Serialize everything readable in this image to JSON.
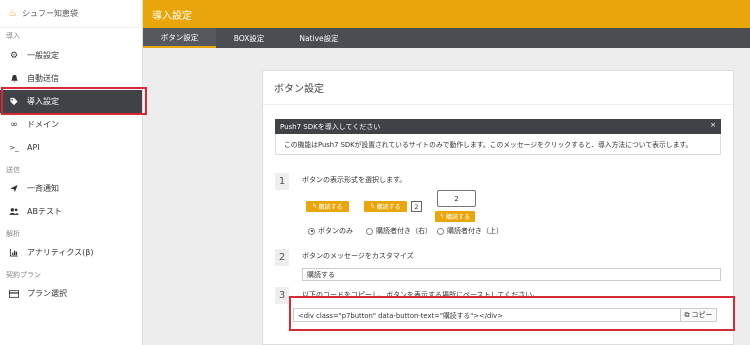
{
  "brand": {
    "name": "シュフー知恵袋",
    "icon": "bottle-icon"
  },
  "sidebar": {
    "sections": [
      {
        "label": "導入",
        "items": [
          {
            "label": "一般設定",
            "icon": "gear-icon"
          },
          {
            "label": "自動送信",
            "icon": "bell-icon"
          },
          {
            "label": "導入設定",
            "icon": "tag-icon",
            "active": true
          },
          {
            "label": "ドメイン",
            "icon": "link-icon"
          },
          {
            "label": "API",
            "icon": "terminal-icon"
          }
        ]
      },
      {
        "label": "送信",
        "items": [
          {
            "label": "一斉通知",
            "icon": "send-icon"
          },
          {
            "label": "ABテスト",
            "icon": "users-icon"
          }
        ]
      },
      {
        "label": "解析",
        "items": [
          {
            "label": "アナリティクス(β)",
            "icon": "bar-chart-icon"
          }
        ]
      },
      {
        "label": "契約プラン",
        "items": [
          {
            "label": "プラン選択",
            "icon": "credit-card-icon"
          }
        ]
      }
    ]
  },
  "header": {
    "title": "導入設定"
  },
  "tabs": [
    {
      "label": "ボタン設定",
      "active": true
    },
    {
      "label": "BOX設定"
    },
    {
      "label": "Native設定"
    }
  ],
  "card": {
    "title": "ボタン設定",
    "alert": {
      "title": "Push7 SDKを導入してください",
      "close": "×",
      "body": "この機能はPush7 SDKが設置されているサイトのみで動作します。このメッセージをクリックすると、導入方法について表示します。"
    },
    "step1": {
      "num": "1",
      "label": "ボタンの表示形式を選択します。",
      "button_label": "購読する",
      "count": "2",
      "options": [
        {
          "label": "ボタンのみ",
          "selected": true
        },
        {
          "label": "購読者付き（右）"
        },
        {
          "label": "購読者付き（上）"
        }
      ]
    },
    "step2": {
      "num": "2",
      "label": "ボタンのメッセージをカスタマイズ",
      "value": "購読する"
    },
    "step3": {
      "num": "3",
      "label": "以下のコードをコピーし、ボタンを表示する場所にペーストしてください。",
      "code": "<div class=\"p7button\" data-button-text=\"購読する\"></div>",
      "copy_label": "コピー"
    }
  },
  "colors": {
    "accent": "#e9a60a",
    "dark": "#3f4348",
    "highlight": "#d62b35"
  }
}
